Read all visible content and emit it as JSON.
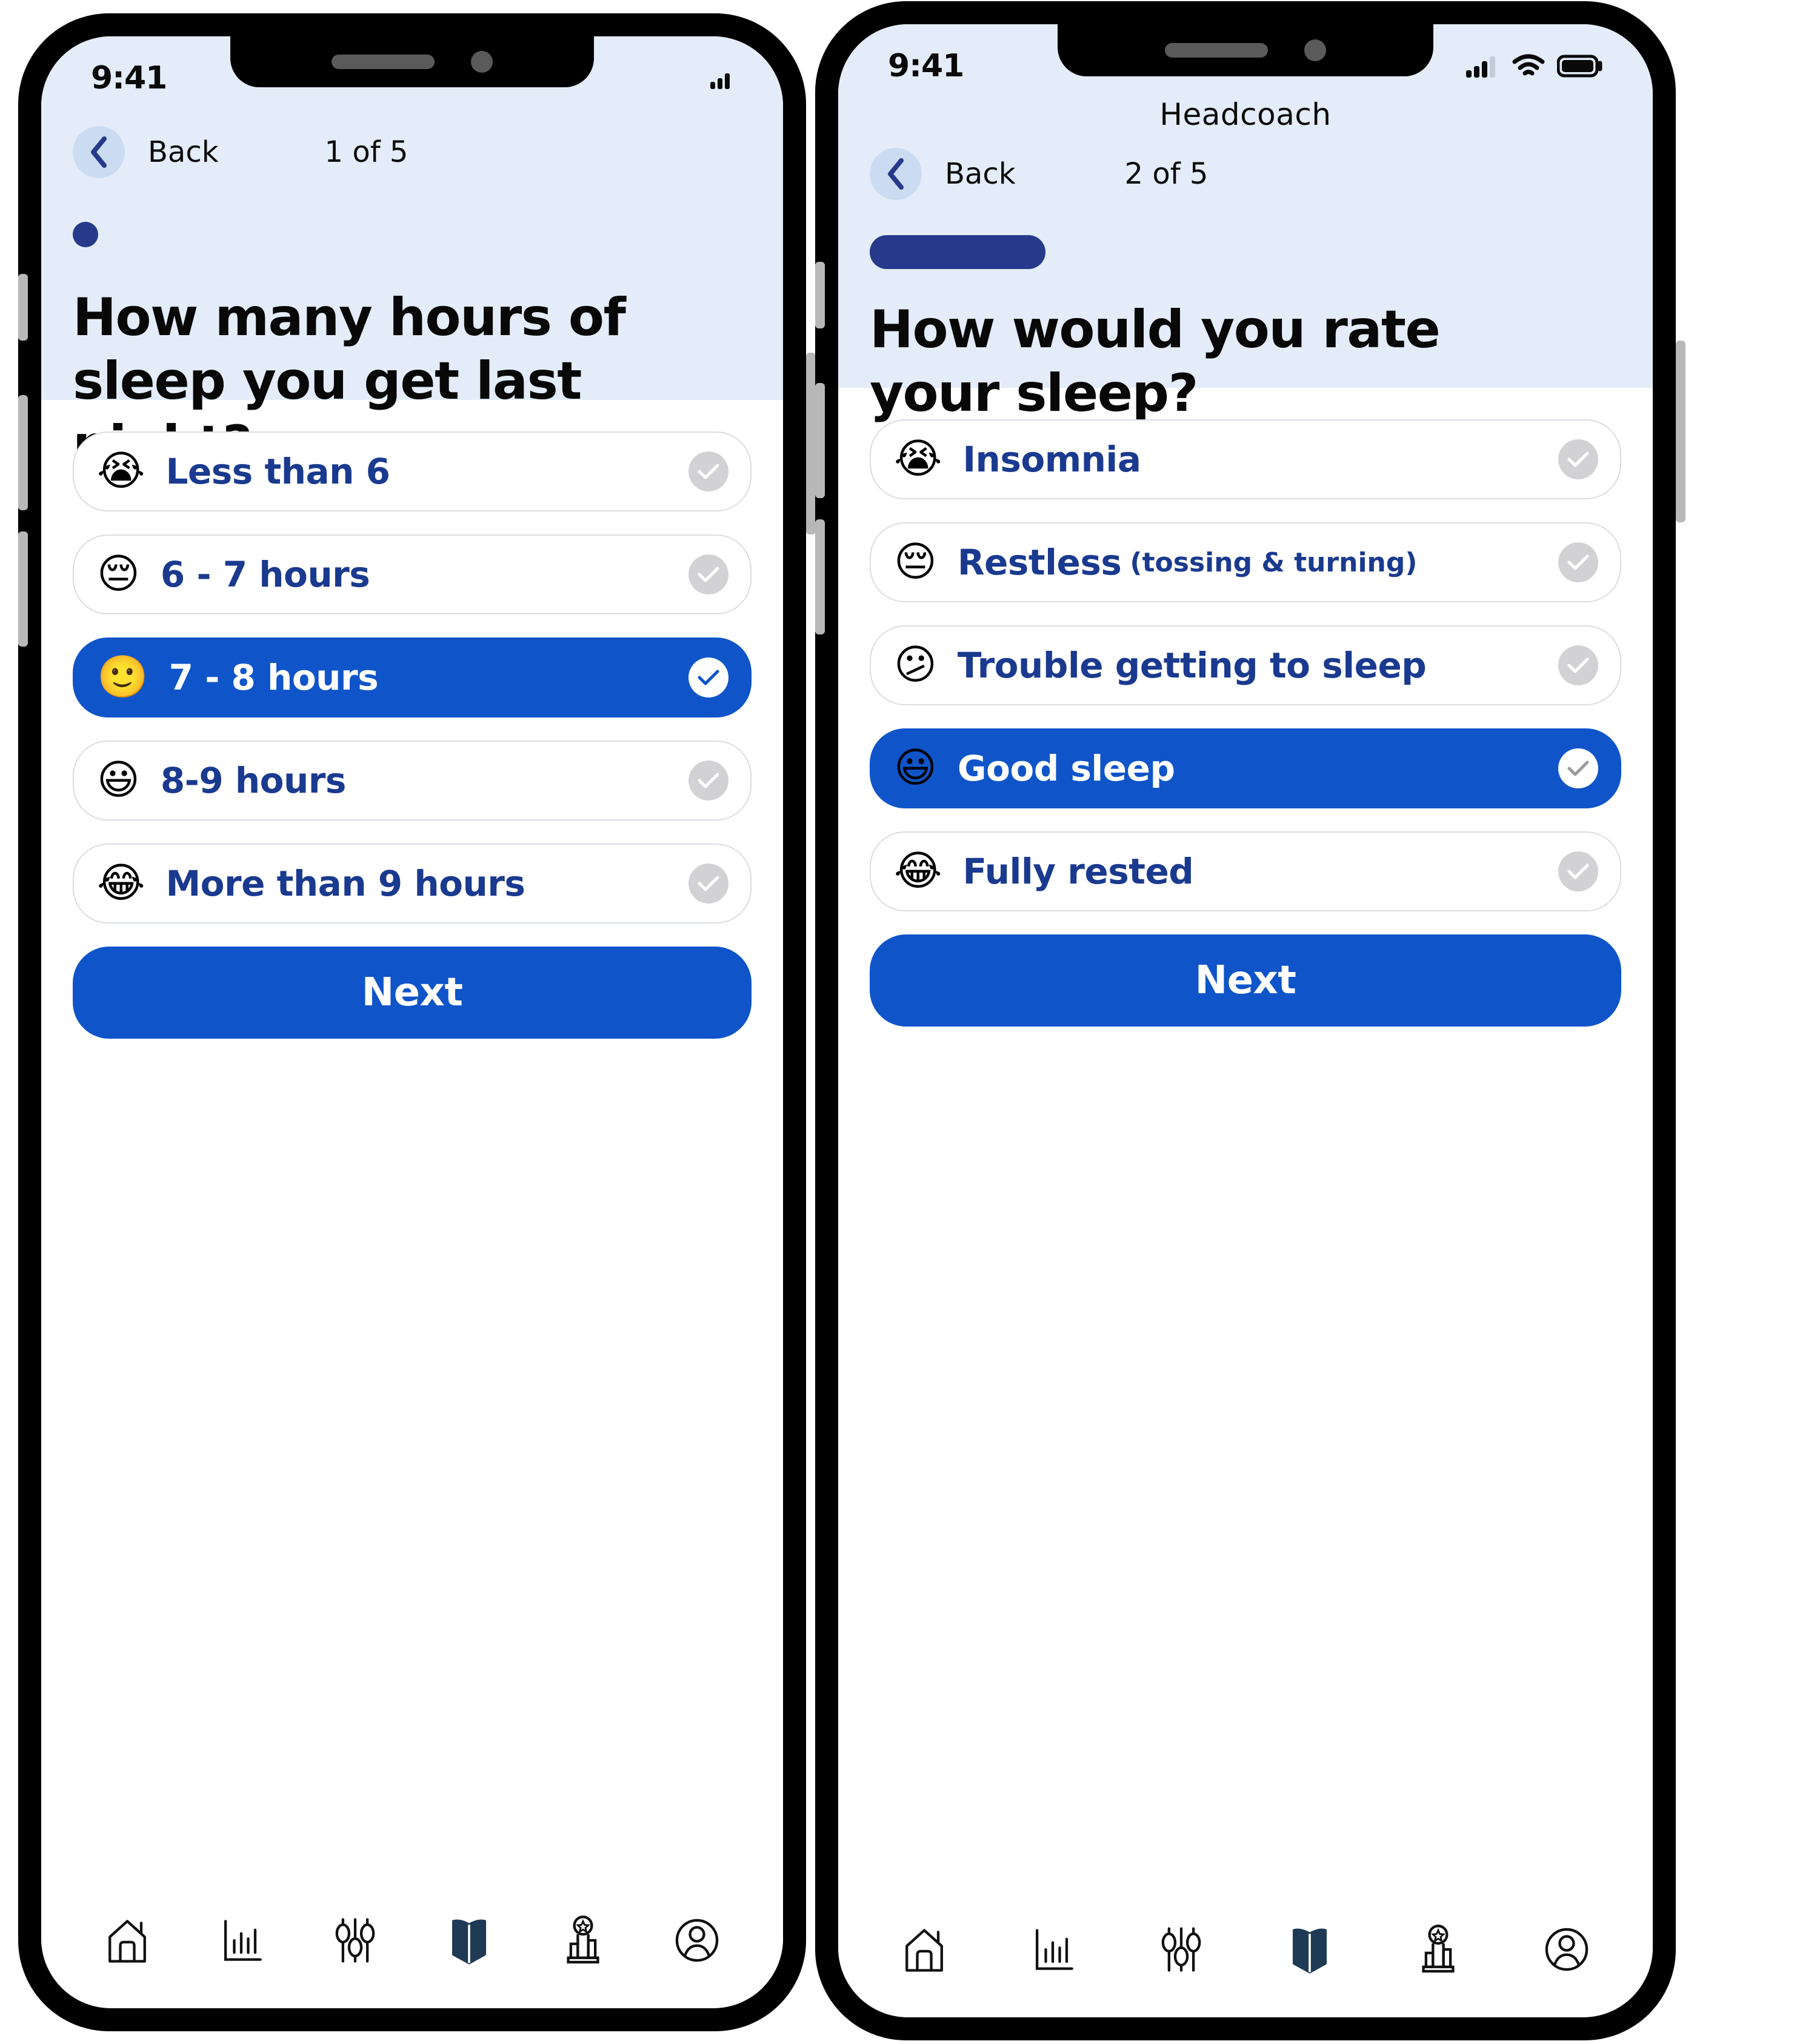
{
  "app": {
    "title": "Headcoach",
    "accent_blue": "#0f55c9",
    "navy": "#1a3a8f",
    "dark_navy": "#27398a",
    "hero_bg": "#e3ecf8",
    "back_circle_bg": "#cbdcf2",
    "check_inactive": "#d2d2d4"
  },
  "left_phone": {
    "status": {
      "time": "9:41",
      "signal": "signal-icon",
      "wifi": "",
      "battery": ""
    },
    "nav": {
      "back_label": "Back",
      "step_label": "1 of 5"
    },
    "question": "How many hours of sleep you get last night?",
    "progress": {
      "type": "dot"
    },
    "options": [
      {
        "emoji": "😭",
        "label": "Less than 6",
        "sub": "",
        "selected": false
      },
      {
        "emoji": "😔",
        "label": "6 - 7 hours",
        "sub": "",
        "selected": false
      },
      {
        "emoji": "🙂",
        "label": "7 - 8 hours",
        "sub": "",
        "selected": true
      },
      {
        "emoji": "😃",
        "label": "8-9 hours",
        "sub": "",
        "selected": false
      },
      {
        "emoji": "😂",
        "label": "More than 9 hours",
        "sub": "",
        "selected": false
      }
    ],
    "next_label": "Next",
    "tabs": [
      {
        "name": "home",
        "active": false
      },
      {
        "name": "stats",
        "active": false
      },
      {
        "name": "sliders",
        "active": false
      },
      {
        "name": "book",
        "active": true
      },
      {
        "name": "podium",
        "active": false
      },
      {
        "name": "profile",
        "active": false
      }
    ]
  },
  "right_phone": {
    "status": {
      "time": "9:41",
      "signal": "signal-icon",
      "wifi": "wifi-icon",
      "battery": "battery-icon"
    },
    "app_title": "Headcoach",
    "nav": {
      "back_label": "Back",
      "step_label": "2 of 5"
    },
    "question": "How would you rate your sleep?",
    "progress": {
      "type": "pill"
    },
    "options": [
      {
        "emoji": "😭",
        "label": "Insomnia",
        "sub": "",
        "selected": false
      },
      {
        "emoji": "😔",
        "label": "Restless",
        "sub": "(tossing & turning)",
        "selected": false
      },
      {
        "emoji": "😕",
        "label": "Trouble getting to sleep",
        "sub": "",
        "selected": false
      },
      {
        "emoji": "😃",
        "label": "Good sleep",
        "sub": "",
        "selected": true
      },
      {
        "emoji": "😂",
        "label": "Fully rested",
        "sub": "",
        "selected": false
      }
    ],
    "next_label": "Next",
    "tabs": [
      {
        "name": "home",
        "active": false
      },
      {
        "name": "stats",
        "active": false
      },
      {
        "name": "sliders",
        "active": false
      },
      {
        "name": "book",
        "active": true
      },
      {
        "name": "podium",
        "active": false
      },
      {
        "name": "profile",
        "active": false
      }
    ]
  }
}
